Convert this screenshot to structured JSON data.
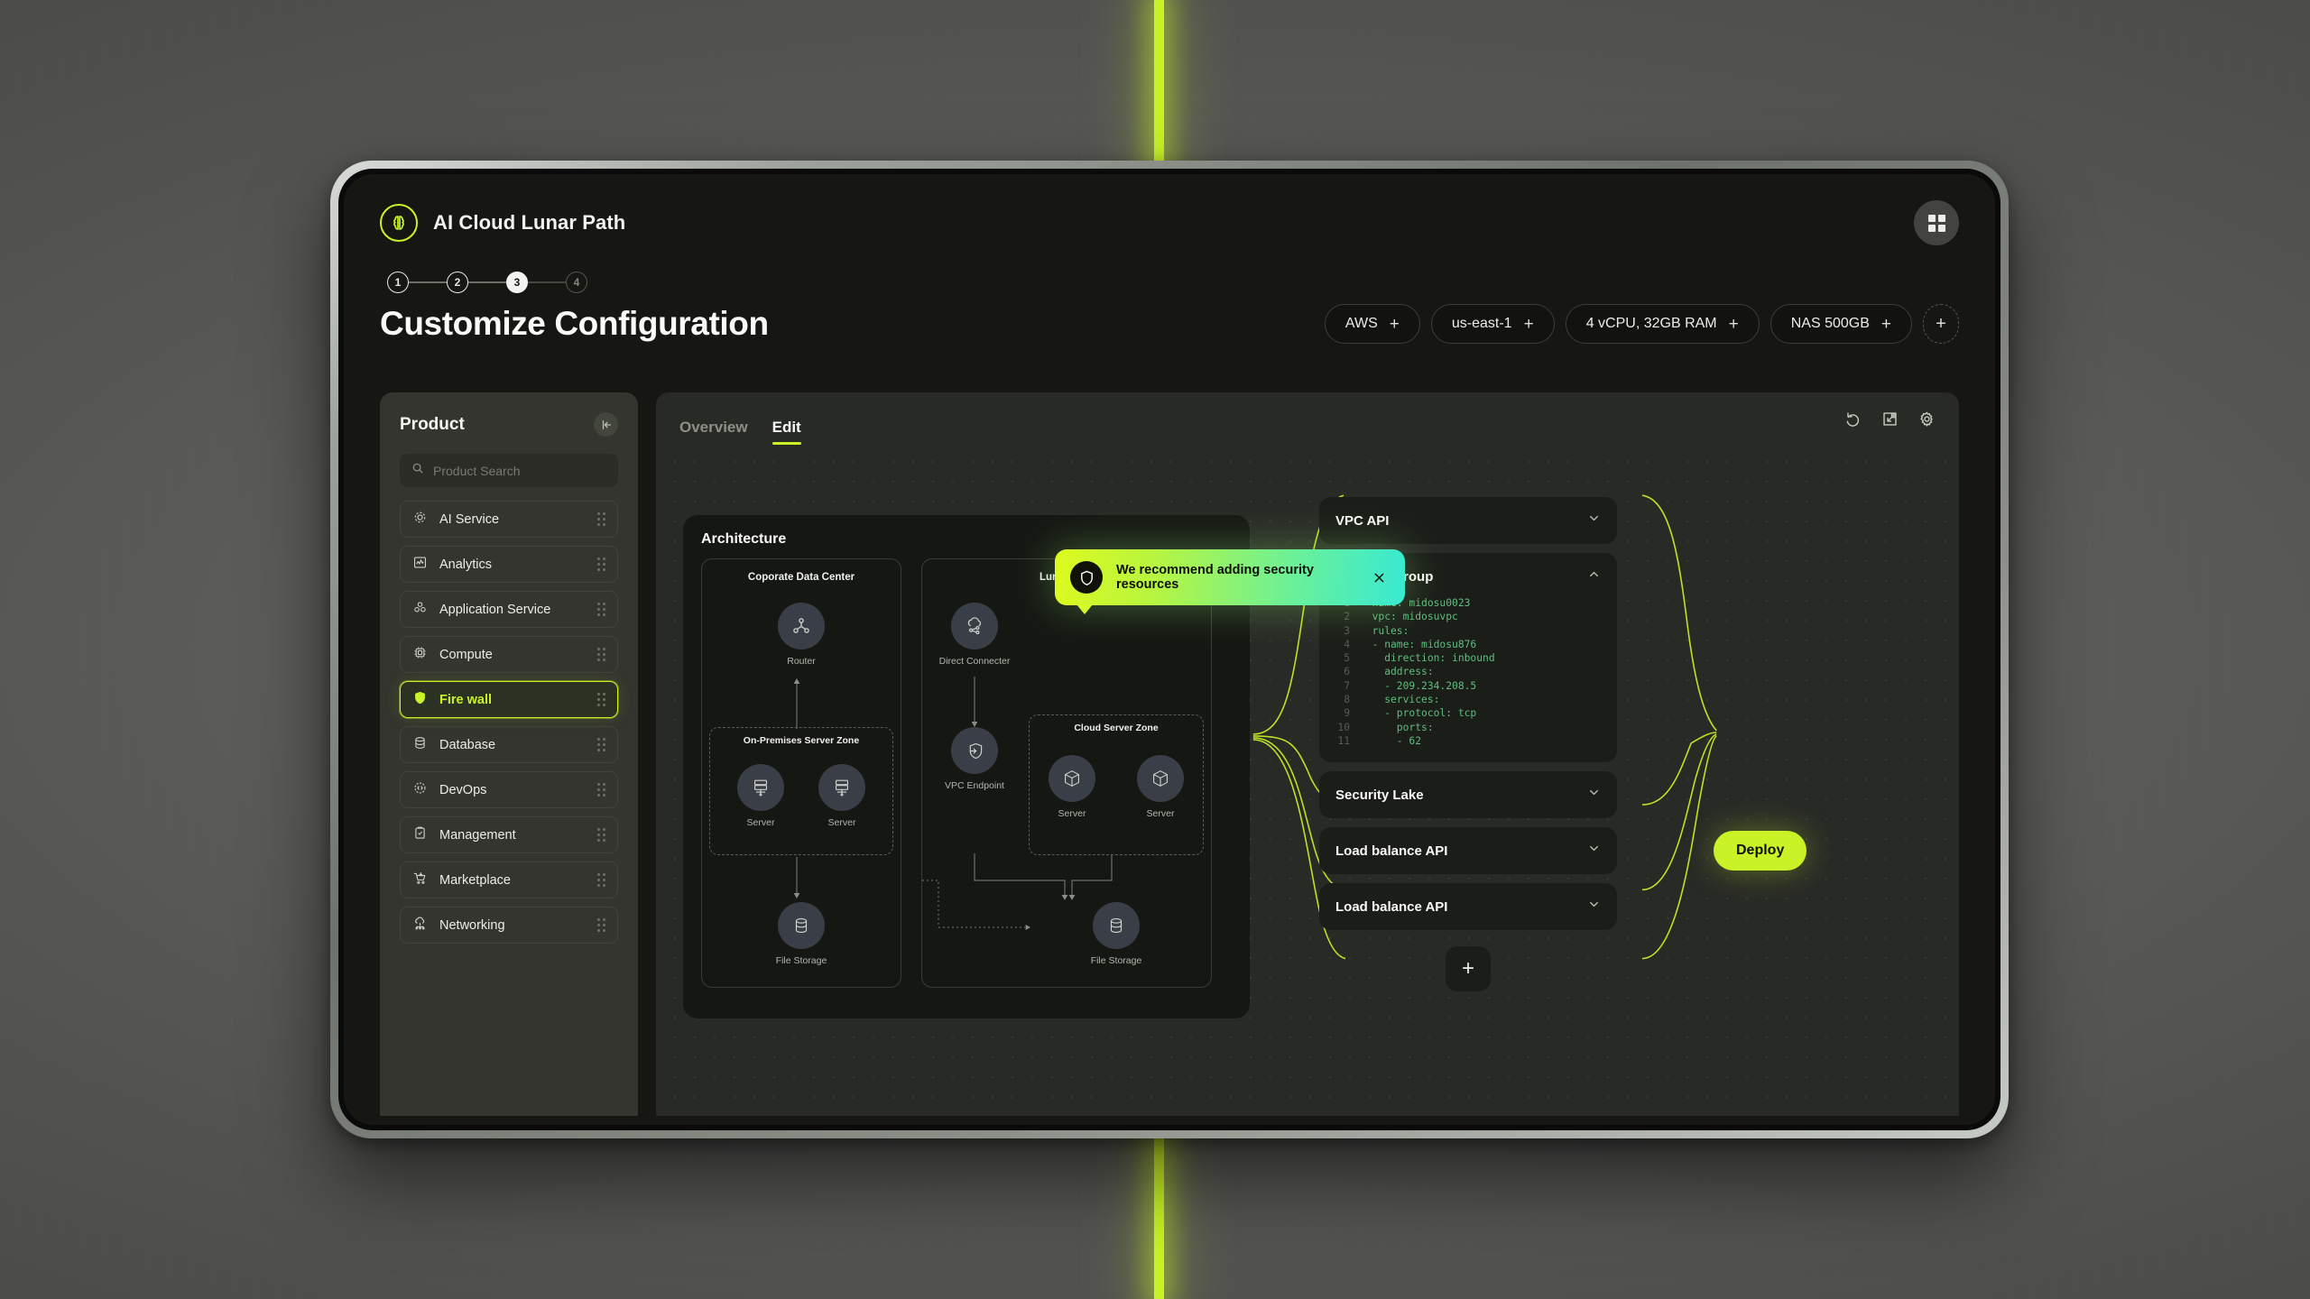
{
  "app": {
    "brand_title": "AI Cloud Lunar Path",
    "brand_mark_icon": "lunar-logo-icon",
    "grid_button_icon": "grid-apps-icon"
  },
  "steps": {
    "items": [
      {
        "number": "1",
        "state": "done"
      },
      {
        "number": "2",
        "state": "done"
      },
      {
        "number": "3",
        "state": "active"
      },
      {
        "number": "4",
        "state": "upcoming"
      }
    ]
  },
  "header": {
    "page_title": "Customize Configuration",
    "chips": [
      {
        "label": "AWS",
        "action": "+"
      },
      {
        "label": "us-east-1",
        "action": "+"
      },
      {
        "label": "4 vCPU, 32GB RAM",
        "action": "+"
      },
      {
        "label": "NAS 500GB",
        "action": "+"
      }
    ],
    "add_chip_label": "+"
  },
  "sidebar": {
    "title": "Product",
    "collapse_icon": "collapse-left-icon",
    "search": {
      "placeholder": "Product Search",
      "value": "",
      "icon": "search-icon"
    },
    "items": [
      {
        "label": "AI Service",
        "icon": "ai-service-icon",
        "selected": false
      },
      {
        "label": "Analytics",
        "icon": "analytics-chart-icon",
        "selected": false
      },
      {
        "label": "Application Service",
        "icon": "application-service-icon",
        "selected": false
      },
      {
        "label": "Compute",
        "icon": "cpu-chip-icon",
        "selected": false
      },
      {
        "label": "Fire wall",
        "icon": "shield-icon",
        "selected": true
      },
      {
        "label": "Database",
        "icon": "database-icon",
        "selected": false
      },
      {
        "label": "DevOps",
        "icon": "devops-gear-icon",
        "selected": false
      },
      {
        "label": "Management",
        "icon": "clipboard-check-icon",
        "selected": false
      },
      {
        "label": "Marketplace",
        "icon": "shopping-cart-icon",
        "selected": false
      },
      {
        "label": "Networking",
        "icon": "cloud-network-icon",
        "selected": false
      }
    ],
    "drag_handle_icon": "drag-handle-icon"
  },
  "canvas": {
    "tabs": [
      {
        "label": "Overview",
        "active": false
      },
      {
        "label": "Edit",
        "active": true
      }
    ],
    "tools": [
      {
        "name": "undo-icon"
      },
      {
        "name": "fit-to-screen-icon"
      },
      {
        "name": "settings-gear-icon"
      }
    ]
  },
  "architecture": {
    "title": "Architecture",
    "zones": [
      {
        "title": "Coporate Data Center",
        "nodes": [
          {
            "label": "Router",
            "icon": "router-icon"
          },
          {
            "label": "File Storage",
            "icon": "database-storage-icon"
          }
        ],
        "subzone": {
          "title": "On-Premises Server Zone",
          "nodes": [
            {
              "label": "Server",
              "icon": "server-rack-icon"
            },
            {
              "label": "Server",
              "icon": "server-rack-icon"
            }
          ]
        }
      },
      {
        "title": "Lunar Path",
        "nodes": [
          {
            "label": "Direct Connecter",
            "icon": "cloud-share-icon"
          },
          {
            "label": "VPC Endpoint",
            "icon": "shield-arrow-icon"
          },
          {
            "label": "File Storage",
            "icon": "database-storage-icon"
          }
        ],
        "subzone": {
          "title": "Cloud Server Zone",
          "nodes": [
            {
              "label": "Server",
              "icon": "cube-icon"
            },
            {
              "label": "Server",
              "icon": "cube-icon"
            }
          ]
        }
      }
    ]
  },
  "config_panels": [
    {
      "name": "VPC API",
      "expanded": false,
      "chevron": "chevron-down-icon"
    },
    {
      "name": "Security Group",
      "expanded": true,
      "chevron": "chevron-up-icon",
      "code_lines": [
        {
          "n": "1",
          "text": "- name: midosu0023"
        },
        {
          "n": "2",
          "text": "  vpc: midosuvpc"
        },
        {
          "n": "3",
          "text": "  rules:"
        },
        {
          "n": "4",
          "text": "  - name: midosu876"
        },
        {
          "n": "5",
          "text": "    direction: inbound"
        },
        {
          "n": "6",
          "text": "    address:"
        },
        {
          "n": "7",
          "text": "    - 209.234.208.5"
        },
        {
          "n": "8",
          "text": "    services:"
        },
        {
          "n": "9",
          "text": "    - protocol: tcp"
        },
        {
          "n": "10",
          "text": "      ports:"
        },
        {
          "n": "11",
          "text": "      - 62"
        }
      ]
    },
    {
      "name": "Security Lake",
      "expanded": false,
      "chevron": "chevron-down-icon"
    },
    {
      "name": "Load balance API",
      "expanded": false,
      "chevron": "chevron-down-icon"
    },
    {
      "name": "Load balance API",
      "expanded": false,
      "chevron": "chevron-down-icon"
    }
  ],
  "config_add_label": "+",
  "deploy": {
    "label": "Deploy"
  },
  "toast": {
    "message": "We recommend adding security resources",
    "icon": "shield-icon",
    "close_icon": "close-icon"
  },
  "colors": {
    "accent": "#c9f227",
    "accent_teal": "#38e9d2",
    "surface": "#282a26",
    "panel": "#1b1d19",
    "sidebar": "#33352e",
    "code_green": "#5fbe7e"
  }
}
